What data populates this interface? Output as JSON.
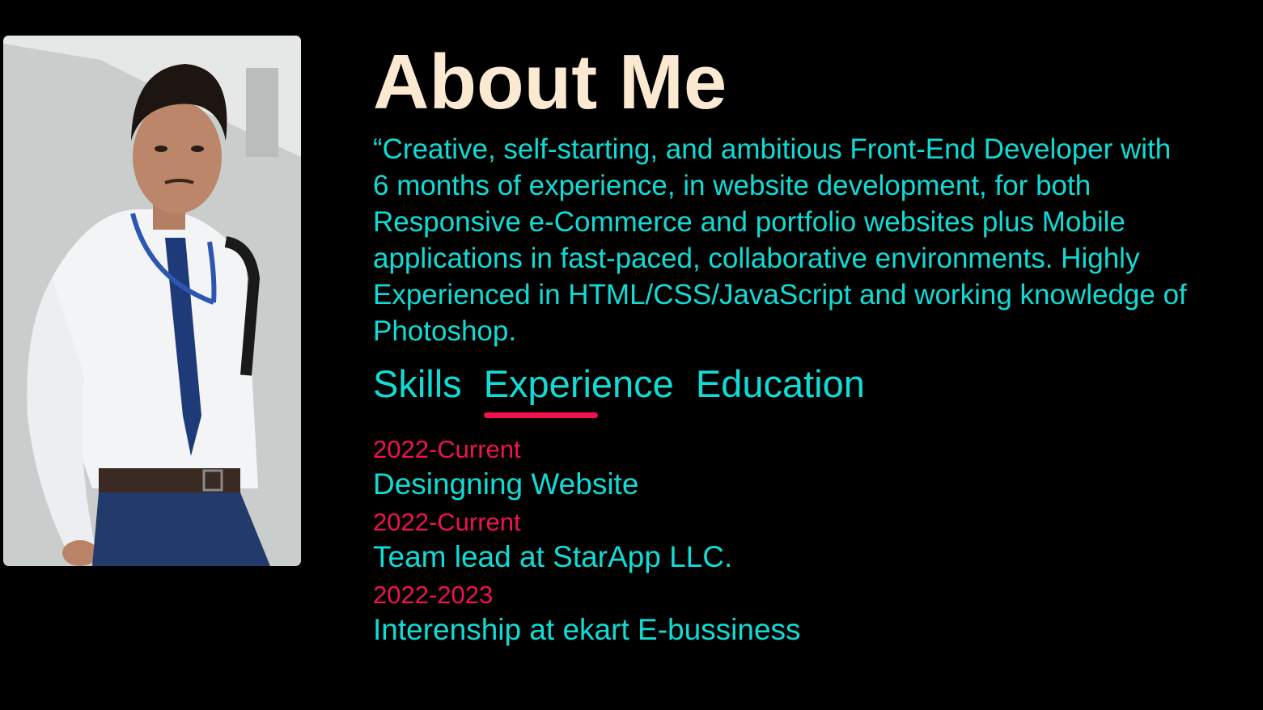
{
  "about": {
    "title": "About Me",
    "bio": "“Creative, self-starting, and ambitious Front-End Developer with 6 months of experience, in website development, for both Responsive e-Commerce and portfolio websites plus Mobile applications in fast-paced, collaborative environments. Highly Experienced in HTML/CSS/JavaScript and working knowledge of Photoshop."
  },
  "tabs": [
    {
      "label": "Skills",
      "active": false
    },
    {
      "label": "Experience",
      "active": true
    },
    {
      "label": "Education",
      "active": false
    }
  ],
  "experience": [
    {
      "date": "2022-Current",
      "title": "Desingning Website"
    },
    {
      "date": "2022-Current",
      "title": "Team lead at StarApp LLC."
    },
    {
      "date": "2022-2023",
      "title": "Interenship at ekart E-bussiness"
    }
  ],
  "colors": {
    "background": "#000000",
    "title": "#fbe9d2",
    "text": "#10dcd6",
    "accent": "#f1124e"
  }
}
